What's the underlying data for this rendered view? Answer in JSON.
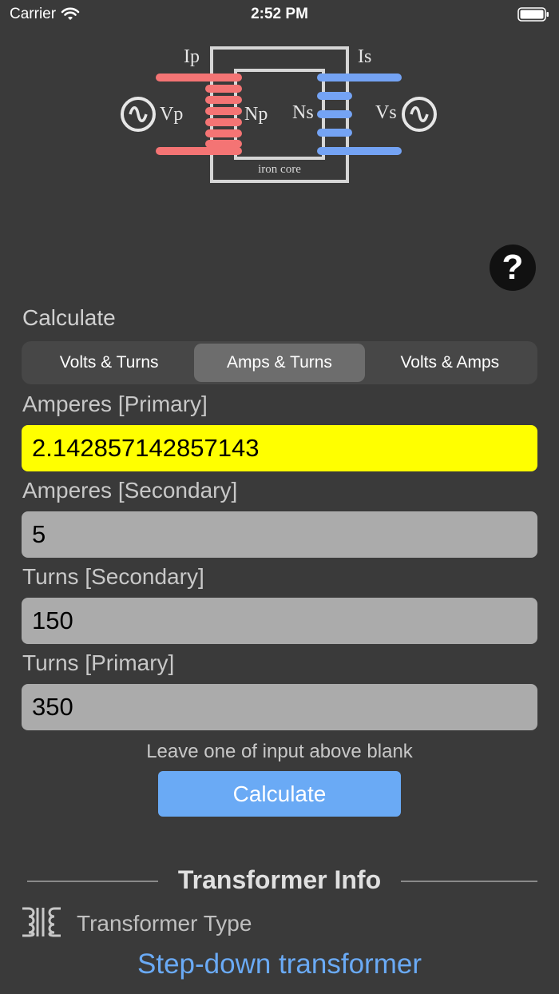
{
  "status": {
    "carrier": "Carrier",
    "time": "2:52 PM"
  },
  "diagram": {
    "label_ip": "Ip",
    "label_is": "Is",
    "label_vp": "Vp",
    "label_vs": "Vs",
    "label_np": "Np",
    "label_ns": "Ns",
    "label_core": "iron core",
    "primary_color": "#f47474",
    "secondary_color": "#74a3f4"
  },
  "help": {
    "label": "?"
  },
  "calculate": {
    "label": "Calculate",
    "segments": [
      "Volts & Turns",
      "Amps & Turns",
      "Volts & Amps"
    ],
    "selected_segment": "Amps & Turns"
  },
  "fields": [
    {
      "label": "Amperes [Primary]",
      "value": "2.142857142857143"
    },
    {
      "label": "Amperes [Secondary]",
      "value": "5"
    },
    {
      "label": "Turns [Secondary]",
      "value": "150"
    },
    {
      "label": "Turns [Primary]",
      "value": "350"
    }
  ],
  "hint": "Leave one of input above blank",
  "calc_button": "Calculate",
  "info": {
    "title": "Transformer Info",
    "type_label": "Transformer Type",
    "type_value": "Step-down transformer",
    "icon": "transformer-icon"
  },
  "colors": {
    "background": "#3a3a3a",
    "highlight": "#ffff00",
    "accent": "#6aaaf5"
  }
}
